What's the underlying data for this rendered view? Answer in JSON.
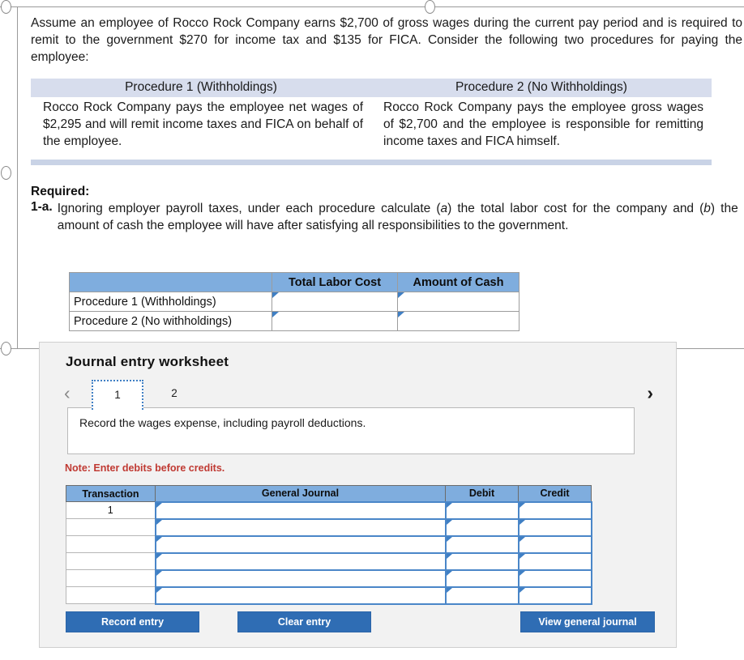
{
  "question": {
    "intro": "Assume an employee of Rocco Rock Company earns $2,700 of gross wages during the current pay period and is required to remit to the government $270 for income tax and $135 for FICA. Consider the following two procedures for paying the employee:",
    "procedures": {
      "headers": [
        "Procedure 1 (Withholdings)",
        "Procedure 2 (No Withholdings)"
      ],
      "cells": [
        "Rocco Rock Company pays the employee net wages of $2,295 and will remit income taxes and FICA on behalf of the employee.",
        "Rocco Rock Company pays the employee gross wages of $2,700 and the employee is responsible for remitting income taxes and FICA himself."
      ]
    },
    "required_label": "Required:",
    "item_number": "1-a.",
    "item_text_1": "Ignoring employer payroll taxes, under each procedure calculate (",
    "item_italic_a": "a",
    "item_text_2": ") the total labor cost for the company and (",
    "item_italic_b": "b",
    "item_text_3": ") the amount of cash the employee will have after satisfying all responsibilities to the government."
  },
  "answer_table": {
    "columns": [
      "",
      "Total Labor Cost",
      "Amount of Cash"
    ],
    "rows": [
      {
        "label": "Procedure 1 (Withholdings)",
        "total_labor_cost": "",
        "amount_of_cash": ""
      },
      {
        "label": "Procedure 2 (No withholdings)",
        "total_labor_cost": "",
        "amount_of_cash": ""
      }
    ]
  },
  "worksheet": {
    "title": "Journal entry worksheet",
    "prev_arrow": "‹",
    "next_arrow": "›",
    "tabs": [
      {
        "label": "1",
        "active": true
      },
      {
        "label": "2",
        "active": false
      }
    ],
    "prompt": "Record the wages expense, including payroll deductions.",
    "note": "Note: Enter debits before credits.",
    "journal": {
      "columns": [
        "Transaction",
        "General Journal",
        "Debit",
        "Credit"
      ],
      "rows": [
        {
          "transaction": "1",
          "general_journal": "",
          "debit": "",
          "credit": ""
        },
        {
          "transaction": "",
          "general_journal": "",
          "debit": "",
          "credit": ""
        },
        {
          "transaction": "",
          "general_journal": "",
          "debit": "",
          "credit": ""
        },
        {
          "transaction": "",
          "general_journal": "",
          "debit": "",
          "credit": ""
        },
        {
          "transaction": "",
          "general_journal": "",
          "debit": "",
          "credit": ""
        },
        {
          "transaction": "",
          "general_journal": "",
          "debit": "",
          "credit": ""
        }
      ]
    },
    "buttons": {
      "record": "Record entry",
      "clear": "Clear entry",
      "view": "View general journal"
    }
  },
  "colors": {
    "header_blue": "#7fadde",
    "button_blue": "#2f6db4",
    "band_blue": "#d7dded",
    "note_red": "#c03a33",
    "input_border": "#4a86c8"
  }
}
